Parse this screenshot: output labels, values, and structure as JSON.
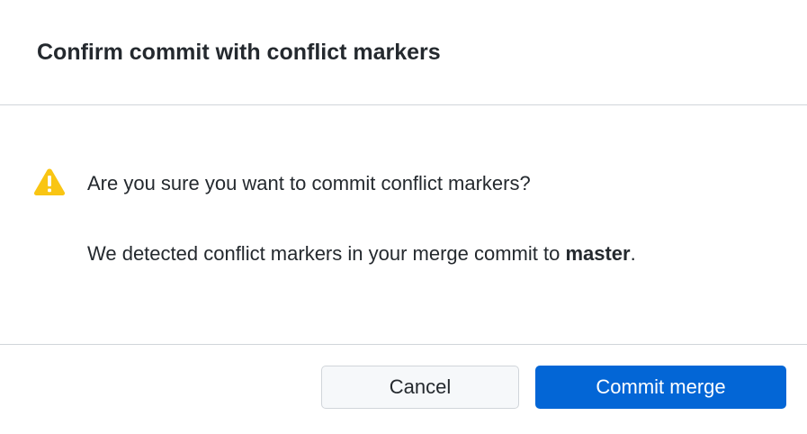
{
  "dialog": {
    "title": "Confirm commit with conflict markers",
    "icon": "warning-icon",
    "question": "Are you sure you want to commit conflict markers?",
    "detail_prefix": "We detected conflict markers in your merge commit to ",
    "branch": "master",
    "detail_suffix": ".",
    "cancel_label": "Cancel",
    "confirm_label": "Commit merge"
  },
  "colors": {
    "primary": "#0366d6",
    "warning": "#f9c513",
    "border": "#d1d5da",
    "text": "#24292e"
  }
}
